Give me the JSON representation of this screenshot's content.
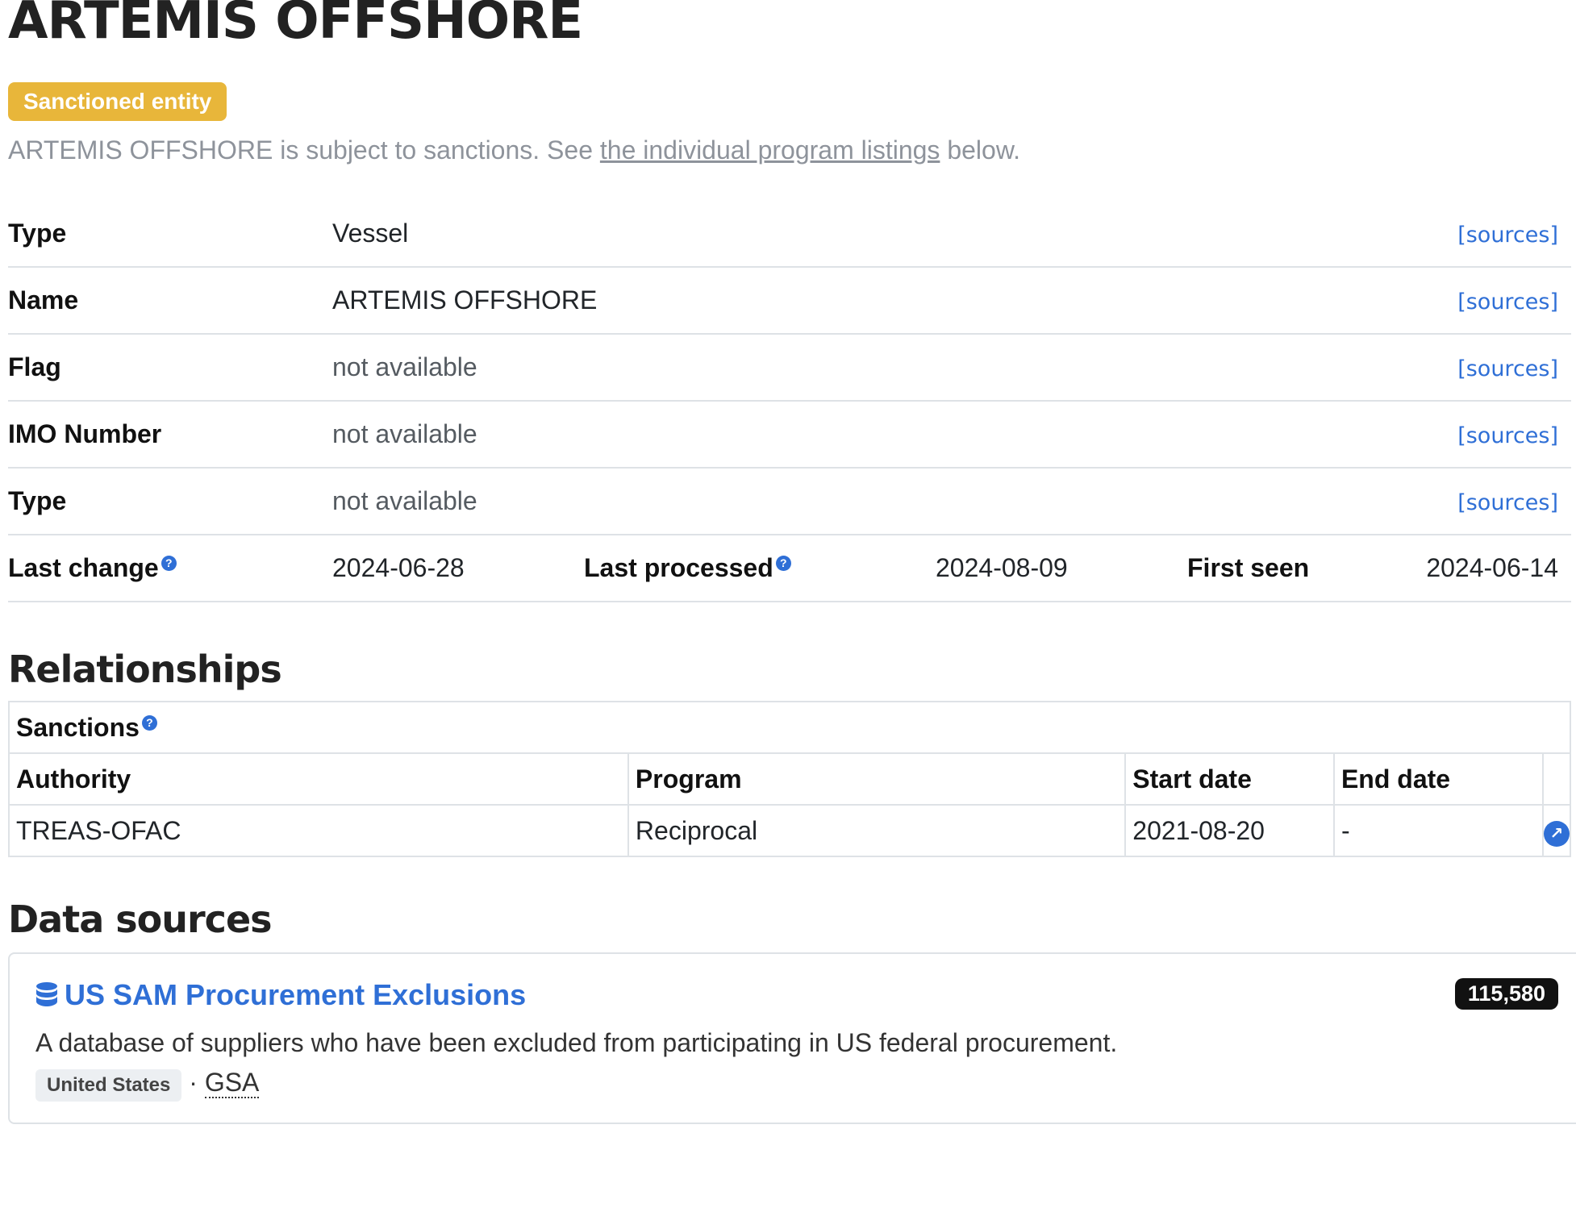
{
  "entity": {
    "title": "ARTEMIS OFFSHORE",
    "badge": "Sanctioned entity",
    "subtitle_prefix": "ARTEMIS OFFSHORE is subject to sanctions. See ",
    "subtitle_link": "the individual program listings",
    "subtitle_suffix": " below."
  },
  "properties": [
    {
      "key": "Type",
      "value": "Vessel",
      "sources": "[sources]"
    },
    {
      "key": "Name",
      "value": "ARTEMIS OFFSHORE",
      "sources": "[sources]"
    },
    {
      "key": "Flag",
      "value": "not available",
      "sources": "[sources]"
    },
    {
      "key": "IMO Number",
      "value": "not available",
      "sources": "[sources]"
    },
    {
      "key": "Type",
      "value": "not available",
      "sources": "[sources]"
    }
  ],
  "dates": {
    "last_change_label": "Last change",
    "last_change_value": "2024-06-28",
    "last_processed_label": "Last processed",
    "last_processed_value": "2024-08-09",
    "first_seen_label": "First seen",
    "first_seen_value": "2024-06-14",
    "help_glyph": "?"
  },
  "relationships": {
    "title": "Relationships",
    "caption": "Sanctions",
    "headers": [
      "Authority",
      "Program",
      "Start date",
      "End date"
    ],
    "rows": [
      {
        "authority": "TREAS-OFAC",
        "program": "Reciprocal",
        "start": "2021-08-20",
        "end": "-",
        "link_icon": "arrow-up-right-icon"
      }
    ],
    "arrow_glyph": "↗"
  },
  "data_sources": {
    "title": "Data sources",
    "items": [
      {
        "name": "US SAM Procurement Exclusions",
        "count": "115,580",
        "description": "A database of suppliers who have been excluded from participating in US federal procurement.",
        "country": "United States",
        "separator": "·",
        "publisher": "GSA",
        "icon": "database-icon"
      }
    ]
  },
  "colors": {
    "accent": "#2f6fd6",
    "badge": "#e8b63a",
    "border": "#dee2e6"
  }
}
